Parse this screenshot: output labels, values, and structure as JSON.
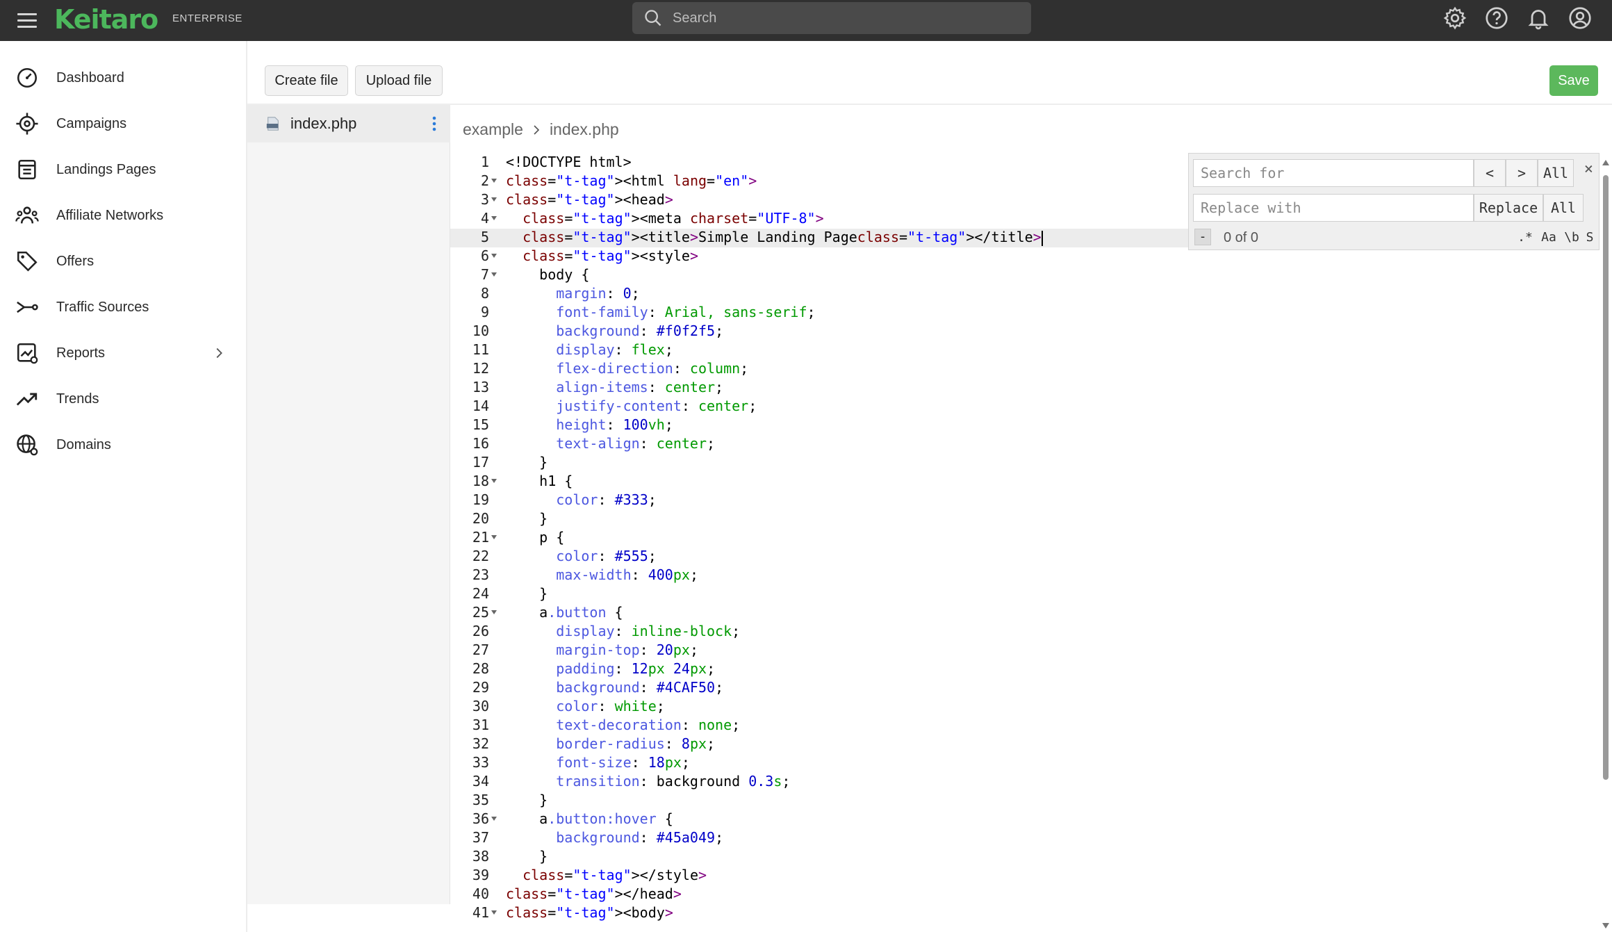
{
  "topbar": {
    "logo": "Keitaro",
    "edition": "ENTERPRISE",
    "search_placeholder": "Search",
    "icons": [
      "gear-icon",
      "help-icon",
      "bell-icon",
      "account-icon"
    ]
  },
  "sidebar": {
    "items": [
      {
        "label": "Dashboard",
        "icon": "dashboard-icon"
      },
      {
        "label": "Campaigns",
        "icon": "target-icon"
      },
      {
        "label": "Landings Pages",
        "icon": "page-icon"
      },
      {
        "label": "Affiliate Networks",
        "icon": "people-icon"
      },
      {
        "label": "Offers",
        "icon": "tag-icon"
      },
      {
        "label": "Traffic Sources",
        "icon": "route-icon"
      },
      {
        "label": "Reports",
        "icon": "report-icon"
      },
      {
        "label": "Trends",
        "icon": "trend-icon"
      },
      {
        "label": "Domains",
        "icon": "globe-icon"
      }
    ]
  },
  "toolbar": {
    "create_label": "Create file",
    "upload_label": "Upload file",
    "save_label": "Save"
  },
  "files": [
    {
      "name": "index.php"
    }
  ],
  "breadcrumb": {
    "folder": "example",
    "file": "index.php"
  },
  "editor": {
    "active_line": 5,
    "lines": [
      "<!DOCTYPE html>",
      "<html lang=\"en\">",
      "<head>",
      "  <meta charset=\"UTF-8\">",
      "  <title>Simple Landing Page</title>",
      "  <style>",
      "    body {",
      "      margin: 0;",
      "      font-family: Arial, sans-serif;",
      "      background: #f0f2f5;",
      "      display: flex;",
      "      flex-direction: column;",
      "      align-items: center;",
      "      justify-content: center;",
      "      height: 100vh;",
      "      text-align: center;",
      "    }",
      "    h1 {",
      "      color: #333;",
      "    }",
      "    p {",
      "      color: #555;",
      "      max-width: 400px;",
      "    }",
      "    a.button {",
      "      display: inline-block;",
      "      margin-top: 20px;",
      "      padding: 12px 24px;",
      "      background: #4CAF50;",
      "      color: white;",
      "      text-decoration: none;",
      "      border-radius: 8px;",
      "      font-size: 18px;",
      "      transition: background 0.3s;",
      "    }",
      "    a.button:hover {",
      "      background: #45a049;",
      "    }",
      "  </style>",
      "</head>",
      "<body>"
    ],
    "fold_lines": [
      2,
      3,
      4,
      6,
      7,
      18,
      21,
      25,
      36,
      41
    ]
  },
  "find_panel": {
    "search_placeholder": "Search for",
    "replace_placeholder": "Replace with",
    "prev_label": "<",
    "next_label": ">",
    "find_all_label": "All",
    "replace_label": "Replace",
    "replace_all_label": "All",
    "close_label": "×",
    "count": "0 of 0",
    "collapse_label": "-",
    "options": [
      ".*",
      "Aa",
      "\\b",
      "S"
    ]
  },
  "colors": {
    "brand": "#4cb75c",
    "topbar": "#303030",
    "save": "#5cb85c"
  }
}
